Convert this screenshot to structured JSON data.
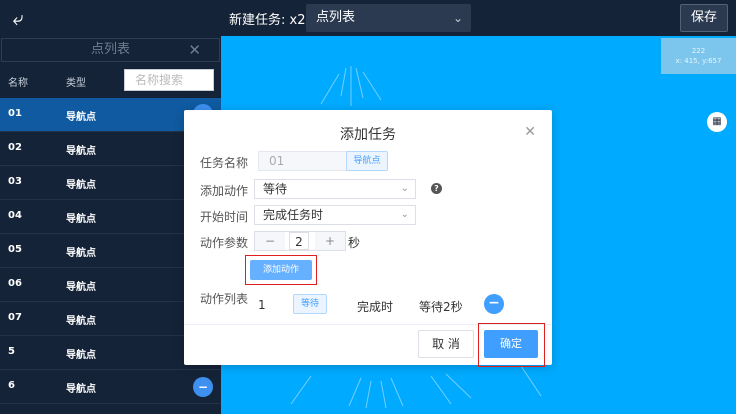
{
  "header": {
    "title": "新建任务: x2",
    "list_select": "点列表",
    "save_label": "保存"
  },
  "sidebar": {
    "title": "点列表",
    "col_name": "名称",
    "col_type": "类型",
    "search_placeholder": "名称搜索",
    "rows": [
      {
        "name": "01",
        "type": "导航点"
      },
      {
        "name": "02",
        "type": "导航点"
      },
      {
        "name": "03",
        "type": "导航点"
      },
      {
        "name": "04",
        "type": "导航点"
      },
      {
        "name": "05",
        "type": "导航点"
      },
      {
        "name": "06",
        "type": "导航点"
      },
      {
        "name": "07",
        "type": "导航点"
      },
      {
        "name": "5",
        "type": "导航点"
      },
      {
        "name": "6",
        "type": "导航点"
      }
    ]
  },
  "map": {
    "coord_id": "222",
    "coord_xy": "x: 415, y:657"
  },
  "modal": {
    "title": "添加任务",
    "task_name_label": "任务名称",
    "task_name_value": "01",
    "task_type_tag": "导航点",
    "add_action_label": "添加动作",
    "add_action_value": "等待",
    "start_time_label": "开始时间",
    "start_time_value": "完成任务时",
    "params_label": "动作参数",
    "params_value": "2",
    "params_unit": "秒",
    "add_action_button": "添加动作",
    "action_list_label": "动作列表",
    "action_row": {
      "index": "1",
      "type": "等待",
      "trigger": "完成时",
      "desc": "等待2秒"
    },
    "cancel_label": "取 消",
    "ok_label": "确定"
  },
  "colors": {
    "header_bg": "#152338",
    "map_bg": "#00aaff",
    "primary": "#409eff",
    "highlight": "#e02020"
  }
}
